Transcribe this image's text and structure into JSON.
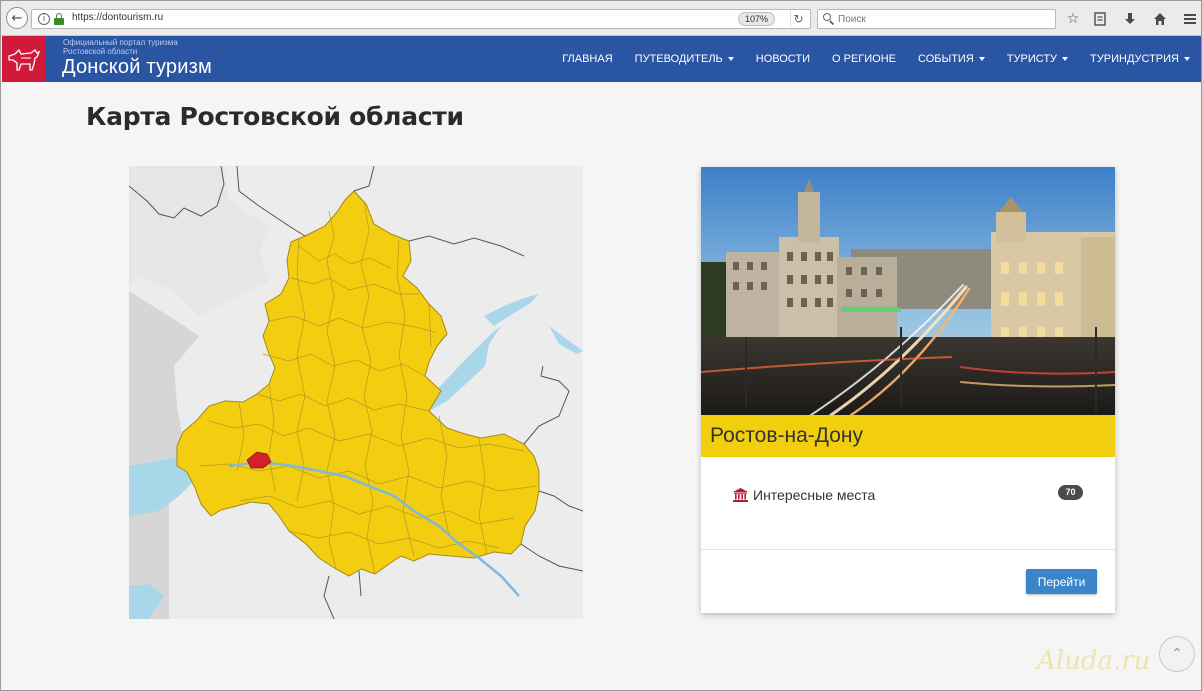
{
  "browser": {
    "url": "https://dontourism.ru",
    "zoom": "107%",
    "search_placeholder": "Поиск"
  },
  "header": {
    "portal_line1": "Официальный портал туризма",
    "portal_line2": "Ростовской области",
    "site_title": "Донской туризм",
    "nav": [
      {
        "label": "ГЛАВНАЯ",
        "dropdown": false
      },
      {
        "label": "ПУТЕВОДИТЕЛЬ",
        "dropdown": true
      },
      {
        "label": "НОВОСТИ",
        "dropdown": false
      },
      {
        "label": "О РЕГИОНЕ",
        "dropdown": false
      },
      {
        "label": "СОБЫТИЯ",
        "dropdown": true
      },
      {
        "label": "ТУРИСТУ",
        "dropdown": true
      },
      {
        "label": "ТУРИНДУСТРИЯ",
        "dropdown": true
      }
    ]
  },
  "page": {
    "title": "Карта Ростовской области"
  },
  "card": {
    "city": "Ростов-на-Дону",
    "places_label": "Интересные места",
    "places_count": "70",
    "button_label": "Перейти"
  },
  "watermark": "Aluda.ru",
  "colors": {
    "header_blue": "#2a55a3",
    "logo_red": "#d11a3a",
    "region_yellow": "#f2cd10",
    "highlight_red": "#d4202a",
    "water_blue": "#a9d7ea",
    "button_blue": "#3a84c9"
  }
}
